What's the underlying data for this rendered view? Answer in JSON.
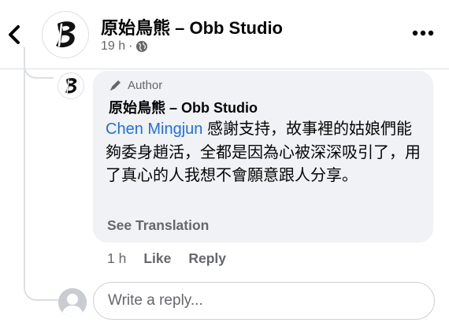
{
  "post_header": {
    "page_name": "原始鳥熊 – Obb Studio",
    "time": "19 h",
    "separator": "·",
    "privacy_icon": "globe-icon",
    "back_icon": "chevron-left-icon",
    "more_icon": "more-dots-icon"
  },
  "comment": {
    "badge_label": "Author",
    "badge_icon": "pen-icon",
    "author_name": "原始鳥熊 – Obb Studio",
    "mention": "Chen Mingjun",
    "text": " 感謝支持，故事裡的姑娘們能夠委身趙活，全都是因為心被深深吸引了，用了真心的人我想不會願意跟人分享。",
    "see_translation": "See Translation",
    "time": "1 h",
    "like_label": "Like",
    "reply_label": "Reply"
  },
  "reply_box": {
    "placeholder": "Write a reply..."
  },
  "colors": {
    "mention": "#216fdb",
    "muted": "#65676b",
    "bubble": "#f0f2f5"
  }
}
